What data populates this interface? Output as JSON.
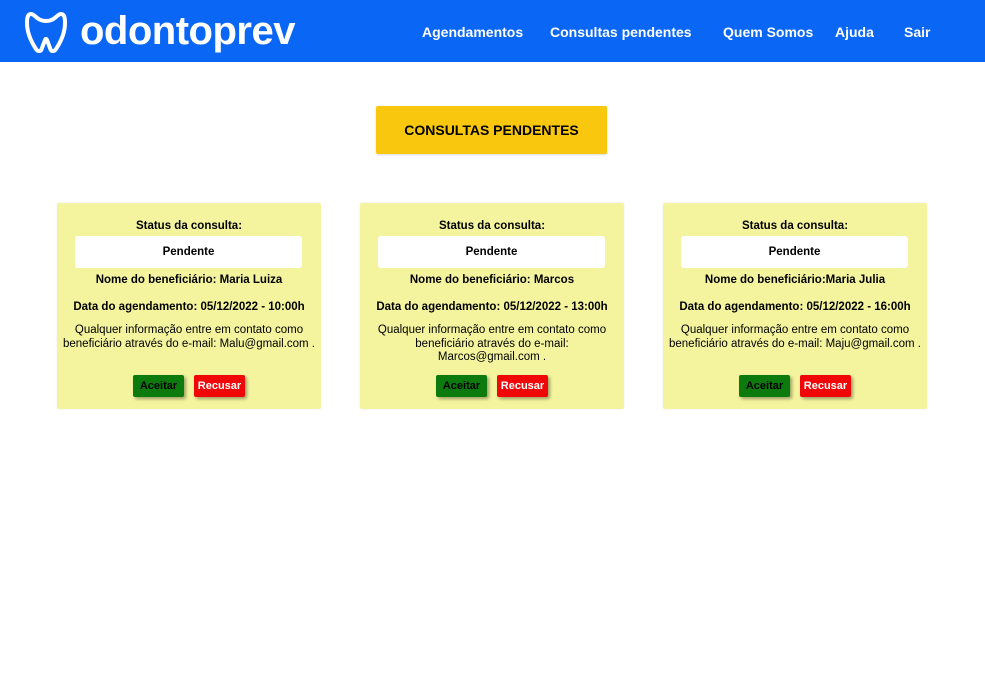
{
  "header": {
    "brand": "odontoprev",
    "logo_icon": "tooth-icon",
    "nav": [
      {
        "label": "Agendamentos"
      },
      {
        "label": "Consultas pendentes"
      },
      {
        "label": "Quem Somos"
      },
      {
        "label": "Ajuda"
      },
      {
        "label": "Sair"
      }
    ],
    "color": "#0a66f5"
  },
  "main": {
    "title": "CONSULTAS PENDENTES",
    "title_color": "#f9c80e"
  },
  "cards": [
    {
      "status_label": "Status da consulta:",
      "status": "Pendente",
      "beneficiary": "Nome do beneficiário: Maria Luiza",
      "date": "Data do agendamento: 05/12/2022 - 10:00h",
      "info": "Qualquer informação entre em contato como beneficiário através do e-mail: Malu@gmail.com .",
      "accept_label": "Aceitar",
      "refuse_label": "Recusar"
    },
    {
      "status_label": "Status da consulta:",
      "status": "Pendente",
      "beneficiary": "Nome do beneficiário: Marcos",
      "date": "Data do agendamento: 05/12/2022 - 13:00h",
      "info": "Qualquer informação entre em contato como beneficiário através do e-mail: Marcos@gmail.com .",
      "accept_label": "Aceitar",
      "refuse_label": "Recusar"
    },
    {
      "status_label": "Status da consulta:",
      "status": "Pendente",
      "beneficiary": "Nome do beneficiário:Maria Julia",
      "date": "Data do agendamento: 05/12/2022 - 16:00h",
      "info": "Qualquer informação entre em contato como beneficiário através do e-mail: Maju@gmail.com .",
      "accept_label": "Aceitar",
      "refuse_label": "Recusar"
    }
  ],
  "colors": {
    "card_bg": "#f4f49e",
    "accept": "#0d7a0d",
    "refuse": "#f00808"
  }
}
